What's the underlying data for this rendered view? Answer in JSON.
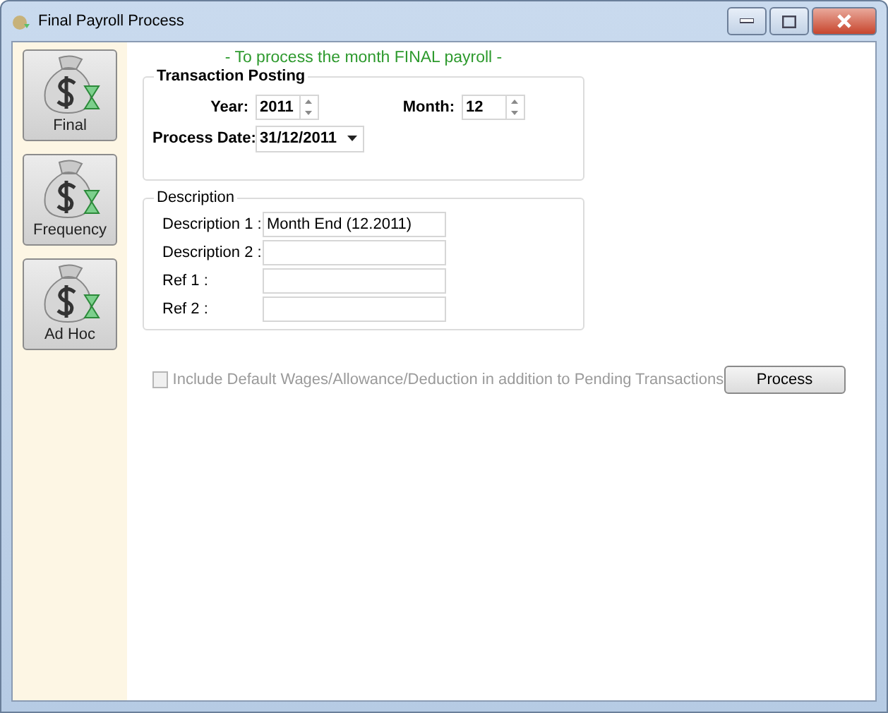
{
  "window": {
    "title": "Final Payroll Process"
  },
  "sidebar": {
    "items": [
      {
        "label": "Final"
      },
      {
        "label": "Frequency"
      },
      {
        "label": "Ad Hoc"
      }
    ]
  },
  "heading": "- To process the month FINAL payroll -",
  "transaction_posting": {
    "title": "Transaction Posting",
    "year_label": "Year:",
    "year": "2011",
    "month_label": "Month:",
    "month": "12",
    "date_label": "Process Date:",
    "date": "31/12/2011"
  },
  "description": {
    "title": "Description",
    "fields": [
      {
        "label": "Description 1 :",
        "value": "Month End (12.2011)"
      },
      {
        "label": "Description 2 :"
      },
      {
        "label": "Ref 1 :"
      },
      {
        "label": "Ref 2 :"
      }
    ]
  },
  "include_default": {
    "label": "Include Default Wages/Allowance/Deduction in addition to Pending Transactions",
    "checked": false,
    "disabled": true
  },
  "process_button": "Process"
}
